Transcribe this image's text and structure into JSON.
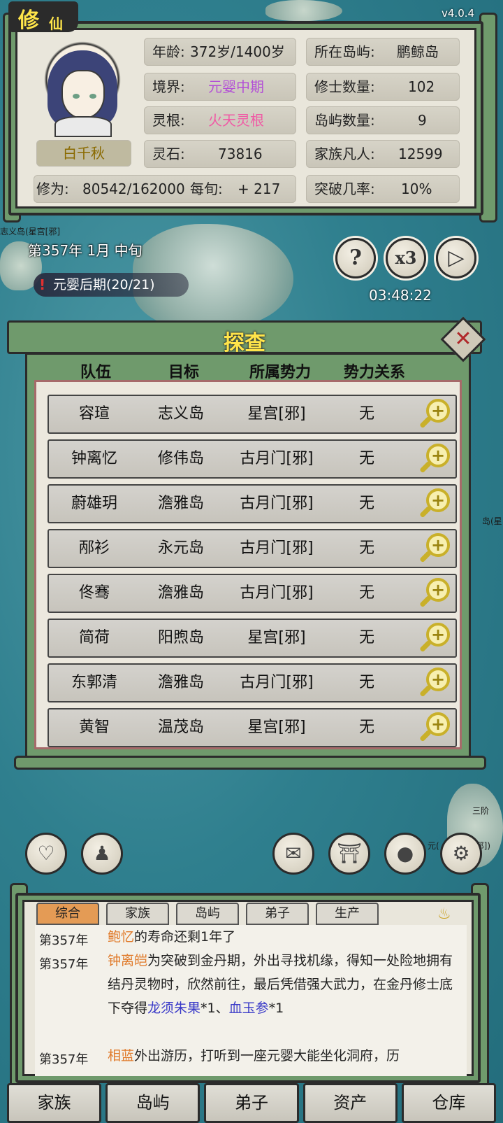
{
  "app": {
    "logo_big": "修",
    "logo_small": "仙",
    "version": "v4.0.4"
  },
  "map": {
    "label_left": "志义岛(星宫[邪]",
    "label_right1": "岛(星",
    "label_right2": "三阶",
    "label_right3": "元(",
    "label_right4": "[邪])"
  },
  "character": {
    "name": "白千秋",
    "age_label": "年龄:",
    "age_value": "372岁/1400岁",
    "realm_label": "境界:",
    "realm_value": "元婴中期",
    "root_label": "灵根:",
    "root_value": "火天灵根",
    "stones_label": "灵石:",
    "stones_value": "73816",
    "cultivation_label": "修为:",
    "cultivation_value": "80542/162000",
    "per_term_label": "每旬:",
    "per_term_value": "+ 217",
    "island_label": "所在岛屿:",
    "island_value": "鹏鲸岛",
    "cultivators_label": "修士数量:",
    "cultivators_value": "102",
    "islands_label": "岛屿数量:",
    "islands_value": "9",
    "mortals_label": "家族凡人:",
    "mortals_value": "12599",
    "breakthrough_label": "突破几率:",
    "breakthrough_value": "10%"
  },
  "status": {
    "date": "第357年 1月 中旬",
    "goal": "元婴后期(20/21)",
    "goal_icon": "!",
    "timer": "03:48:22",
    "help_glyph": "?",
    "speed_label": "x3",
    "play_glyph": "▷"
  },
  "investigate": {
    "title": "探查",
    "close_glyph": "✕",
    "columns": [
      "队伍",
      "目标",
      "所属势力",
      "势力关系"
    ],
    "rows": [
      {
        "team": "容瑄",
        "target": "志义岛",
        "faction": "星宫[邪]",
        "relation": "无"
      },
      {
        "team": "钟离忆",
        "target": "修伟岛",
        "faction": "古月门[邪]",
        "relation": "无"
      },
      {
        "team": "蔚雄玥",
        "target": "澹雅岛",
        "faction": "古月门[邪]",
        "relation": "无"
      },
      {
        "team": "邴衫",
        "target": "永元岛",
        "faction": "古月门[邪]",
        "relation": "无"
      },
      {
        "team": "佟骞",
        "target": "澹雅岛",
        "faction": "古月门[邪]",
        "relation": "无"
      },
      {
        "team": "简荷",
        "target": "阳煦岛",
        "faction": "星宫[邪]",
        "relation": "无"
      },
      {
        "team": "东郭清",
        "target": "澹雅岛",
        "faction": "古月门[邪]",
        "relation": "无"
      },
      {
        "team": "黄智",
        "target": "温茂岛",
        "faction": "星宫[邪]",
        "relation": "无"
      }
    ],
    "row_action_glyph": "+"
  },
  "tools": {
    "horn": "horn-icon",
    "figure": "figure-icon",
    "mail": "mail-icon",
    "gate": "gate-icon",
    "location": "location-icon",
    "gear": "gear-icon"
  },
  "log": {
    "tabs": [
      "综合",
      "家族",
      "岛屿",
      "弟子",
      "生产"
    ],
    "entries": [
      {
        "year": "第357年",
        "name": "鲍忆",
        "text": "的寿命还剩1年了"
      },
      {
        "year": "第357年",
        "name": "钟离皑",
        "text_a": "为突破到金丹期，外出寻找机缘，得知一处险地拥有结丹灵物时，欣然前往，最后凭借强大武力，在金丹修士底下夺得",
        "item1": "龙须朱果",
        "text_b": "*1、",
        "item2": "血玉参",
        "text_c": "*1"
      },
      {
        "year": "第357年",
        "name": "相蓝",
        "text": "外出游历，打听到一座元婴大能坐化洞府，历"
      }
    ]
  },
  "nav": [
    "家族",
    "岛屿",
    "弟子",
    "资产",
    "仓库"
  ]
}
